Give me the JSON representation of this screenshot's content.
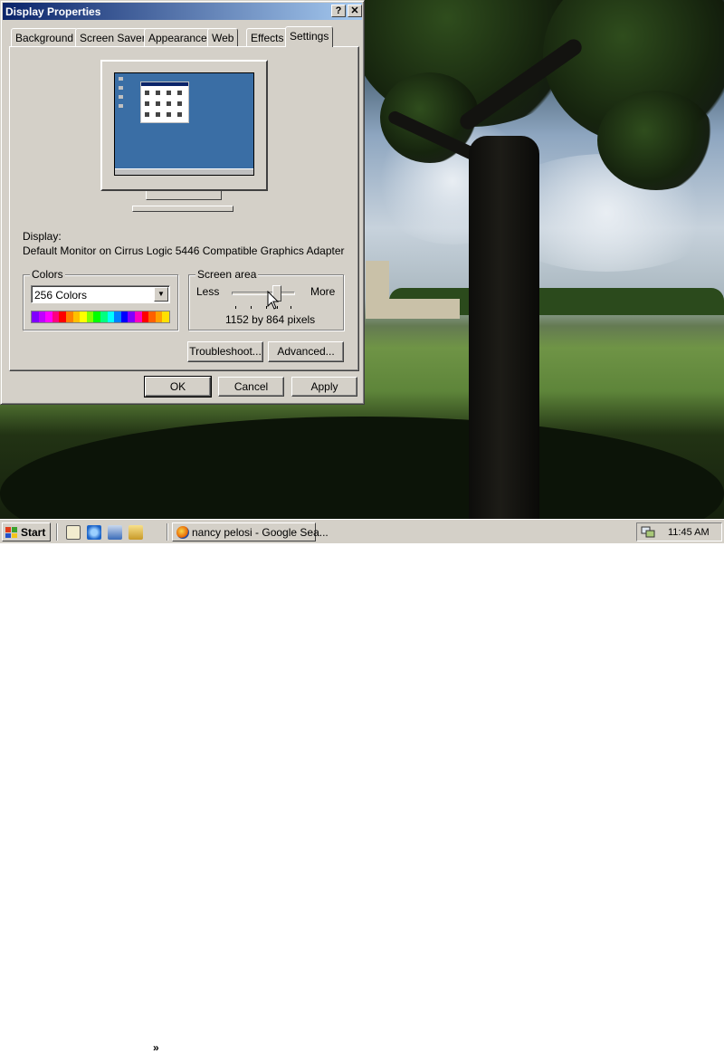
{
  "window": {
    "title": "Display Properties",
    "help_label": "?",
    "close_label": "✕",
    "tabs": [
      {
        "label": "Background",
        "active": false
      },
      {
        "label": "Screen Saver",
        "active": false
      },
      {
        "label": "Appearance",
        "active": false
      },
      {
        "label": "Web",
        "active": false
      },
      {
        "label": "Effects",
        "active": false
      },
      {
        "label": "Settings",
        "active": true
      }
    ]
  },
  "settings": {
    "display_label": "Display:",
    "display_value": "Default Monitor on Cirrus Logic 5446 Compatible Graphics Adapter",
    "colors": {
      "group_label": "Colors",
      "selected": "256 Colors",
      "palette": [
        "#8000ff",
        "#c000ff",
        "#ff00ff",
        "#ff0080",
        "#ff0000",
        "#ff8000",
        "#ffc000",
        "#ffff00",
        "#80ff00",
        "#00ff00",
        "#00ff80",
        "#00ffff",
        "#0080ff",
        "#0000ff",
        "#8000ff",
        "#ff00c0",
        "#ff0000",
        "#ff6000",
        "#ffa000",
        "#ffe000"
      ]
    },
    "screen_area": {
      "group_label": "Screen area",
      "less_label": "Less",
      "more_label": "More",
      "value": "1152 by 864 pixels"
    },
    "troubleshoot_label": "Troubleshoot...",
    "advanced_label": "Advanced..."
  },
  "buttons": {
    "ok": "OK",
    "cancel": "Cancel",
    "apply": "Apply"
  },
  "taskbar": {
    "start_label": "Start",
    "task_label": "nancy pelosi - Google Sea...",
    "more_label": "»",
    "clock": "11:45 AM"
  },
  "colors": {
    "titlebar_start": "#0a246a",
    "titlebar_end": "#a6caf0",
    "face": "#d4d0c8",
    "monitor_screen": "#3a6ea5"
  }
}
